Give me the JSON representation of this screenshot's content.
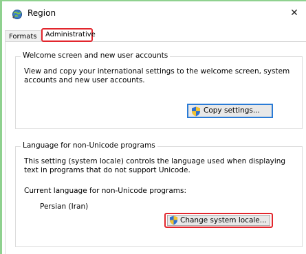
{
  "window": {
    "title": "Region",
    "close_symbol": "✕"
  },
  "tabs": [
    {
      "label": "Formats",
      "selected": false
    },
    {
      "label": "Administrative",
      "selected": true
    }
  ],
  "welcome_group": {
    "title": "Welcome screen and new user accounts",
    "description": "View and copy your international settings to the welcome screen, system accounts and new user accounts.",
    "button": {
      "label": "Copy settings...",
      "icon": "uac-shield-icon"
    }
  },
  "locale_group": {
    "title": "Language for non-Unicode programs",
    "description": "This setting (system locale) controls the language used when displaying text in programs that do not support Unicode.",
    "current_label": "Current language for non-Unicode programs:",
    "current_value": "Persian (Iran)",
    "button": {
      "label": "Change system locale...",
      "icon": "uac-shield-icon"
    }
  },
  "colors": {
    "highlight_red": "#e2262d",
    "focus_blue": "#2a7bd6",
    "side_green": "#8fd18f"
  }
}
